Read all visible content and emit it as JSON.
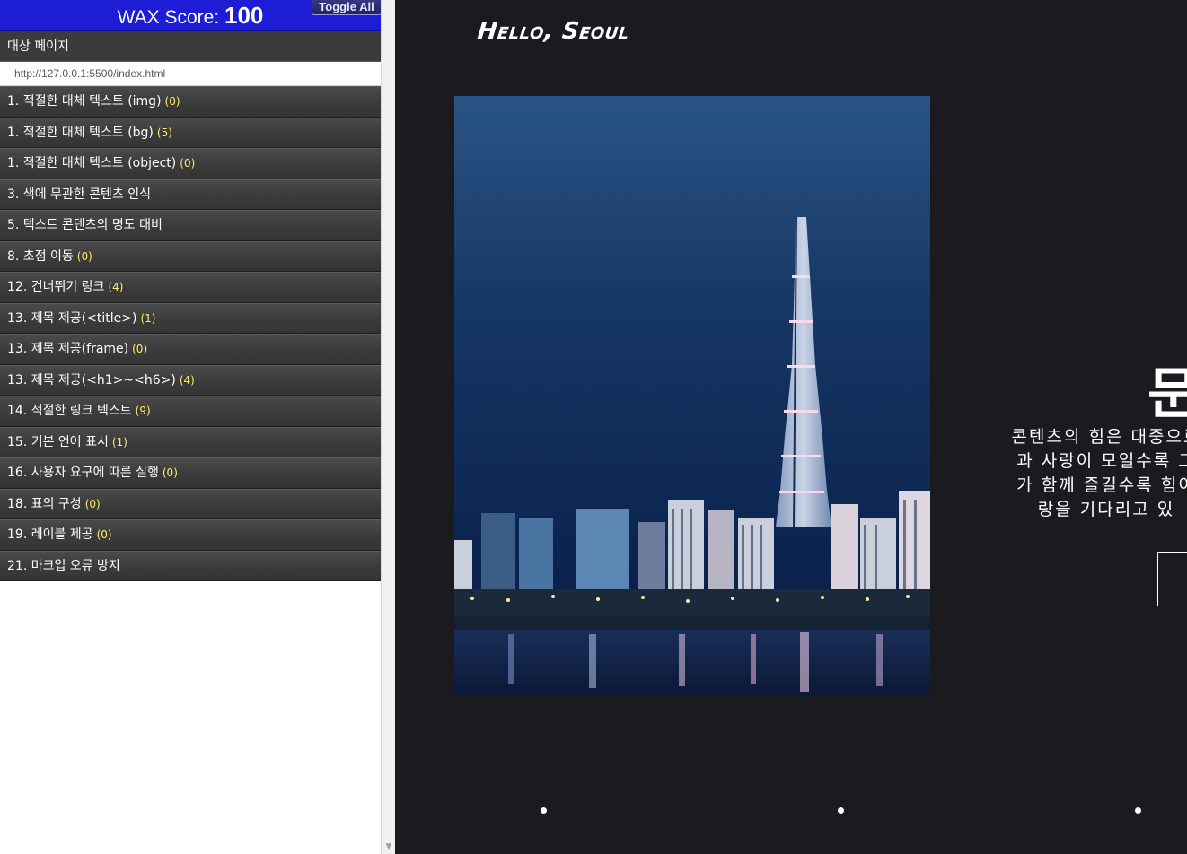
{
  "wax": {
    "score_label": "WAX Score:",
    "score_value": "100",
    "toggle_label": "Toggle All",
    "target_label": "대상 페이지",
    "target_url": "http://127.0.0.1:5500/index.html",
    "items": [
      {
        "label": "1. 적절한 대체 텍스트 (img)",
        "count": "(0)"
      },
      {
        "label": "1. 적절한 대체 텍스트 (bg)",
        "count": "(5)"
      },
      {
        "label": "1. 적절한 대체 텍스트 (object)",
        "count": "(0)"
      },
      {
        "label": "3. 색에 무관한 콘텐츠 인식",
        "count": ""
      },
      {
        "label": "5. 텍스트 콘텐츠의 명도 대비",
        "count": ""
      },
      {
        "label": "8. 초점 이동",
        "count": "(0)"
      },
      {
        "label": "12. 건너뛰기 링크",
        "count": "(4)"
      },
      {
        "label": "13. 제목 제공(<title>)",
        "count": "(1)"
      },
      {
        "label": "13. 제목 제공(frame)",
        "count": "(0)"
      },
      {
        "label": "13. 제목 제공(<h1>~<h6>)",
        "count": "(4)"
      },
      {
        "label": "14. 적절한 링크 텍스트",
        "count": "(9)"
      },
      {
        "label": "15. 기본 언어 표시",
        "count": "(1)"
      },
      {
        "label": "16. 사용자 요구에 따른 실행",
        "count": "(0)"
      },
      {
        "label": "18. 표의 구성",
        "count": "(0)"
      },
      {
        "label": "19. 레이블 제공",
        "count": "(0)"
      },
      {
        "label": "21. 마크업 오류 방지",
        "count": ""
      }
    ]
  },
  "site": {
    "logo": "Hello, Seoul",
    "slide_title": "문",
    "slide_lines": [
      "콘텐츠의 힘은 대중으로",
      "과 사랑이 모일수록 그",
      "가 함께 즐길수록 힘이",
      "랑을 기다리고 있"
    ],
    "photo_icon": "seoul-night-skyline-image"
  },
  "colors": {
    "wax_header": "#1d1dd6",
    "wax_item_bg": "#3b3b3b",
    "wax_count": "#ffee66",
    "site_bg": "#1b1a1f"
  }
}
